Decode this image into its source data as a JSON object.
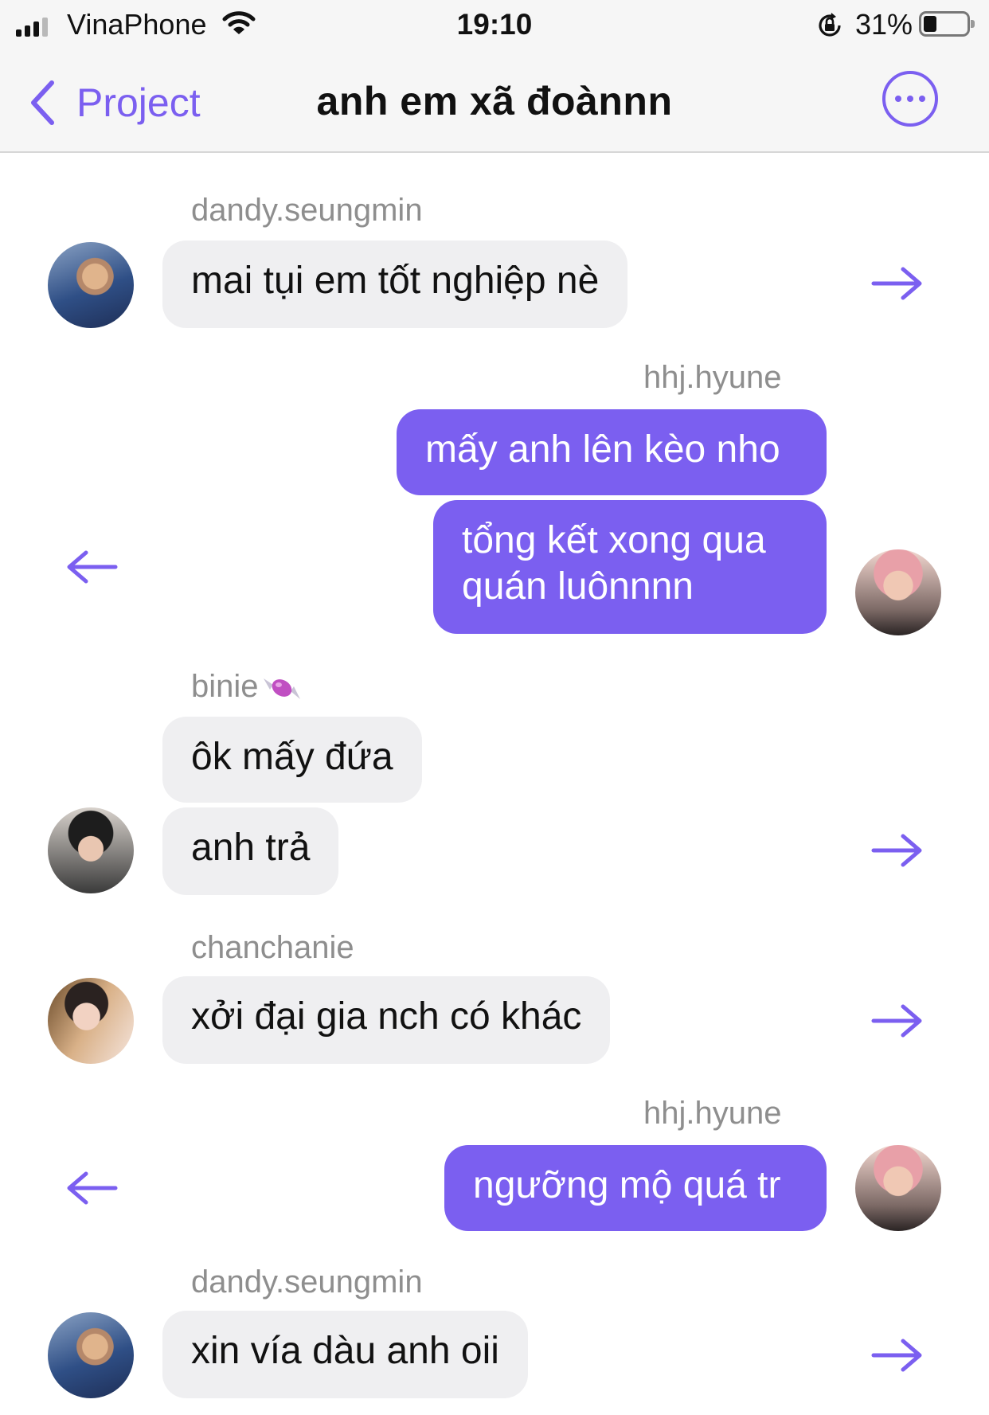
{
  "status_bar": {
    "carrier": "VinaPhone",
    "time": "19:10",
    "battery_percent": "31%",
    "battery_level": 0.31
  },
  "nav": {
    "back_label": "Project",
    "title": "anh em xã đoànnn"
  },
  "colors": {
    "accent": "#7b5ff0",
    "incoming_bubble": "#efeff1",
    "outgoing_bubble": "#7b5ff0",
    "sender_name": "#8e8e8e"
  },
  "messages": [
    {
      "sender": "dandy.seungmin",
      "direction": "incoming",
      "bubbles": [
        "mai tụi em tốt nghiệp nè"
      ]
    },
    {
      "sender": "hhj.hyune",
      "direction": "outgoing",
      "bubbles": [
        "mấy anh lên kèo nho",
        "tổng kết xong qua quán luônnnn"
      ]
    },
    {
      "sender": "binie",
      "sender_emoji": "candy",
      "direction": "incoming",
      "bubbles": [
        "ôk mấy đứa",
        "anh trả"
      ]
    },
    {
      "sender": "chanchanie",
      "direction": "incoming",
      "bubbles": [
        "xởi đại gia nch có khác"
      ]
    },
    {
      "sender": "hhj.hyune",
      "direction": "outgoing",
      "bubbles": [
        "ngưỡng mộ quá tr"
      ]
    },
    {
      "sender": "dandy.seungmin",
      "direction": "incoming",
      "bubbles": [
        "xin vía dàu anh oii"
      ]
    }
  ],
  "icons": {
    "back": "chevron-left-icon",
    "more": "ellipsis-circle-icon",
    "forward": "arrow-right-icon",
    "reply": "arrow-left-icon"
  }
}
